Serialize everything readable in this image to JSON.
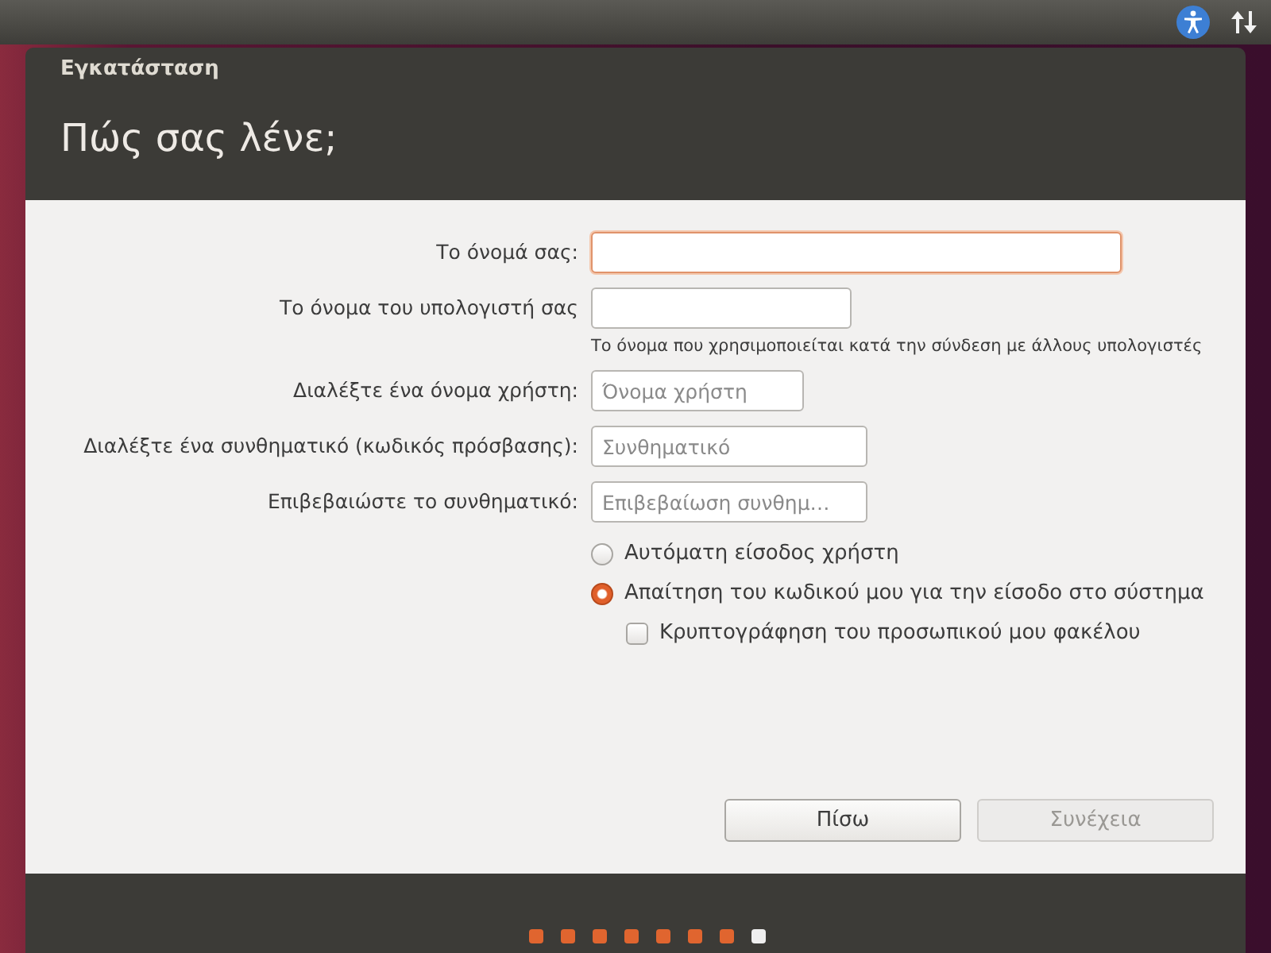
{
  "window": {
    "title": "Εγκατάσταση",
    "heading": "Πώς σας λένε;"
  },
  "fields": [
    {
      "label": "Το όνομά σας:",
      "focused": true
    },
    {
      "label": "Το όνομα του υπολογιστή σας",
      "focused": false,
      "hint": "Το όνομα που χρησιμοποιείται κατά την σύνδεση με άλλους υπολογιστές"
    },
    {
      "label": "Διαλέξτε ένα όνομα χρήστη:",
      "focused": false,
      "placeholder": "Όνομα χρήστη"
    },
    {
      "label": "Διαλέξτε ένα συνθηματικό (κωδικός πρόσβασης):",
      "focused": false,
      "placeholder": "Συνθηματικό"
    },
    {
      "label": "Επιβεβαιώστε το συνθηματικό:",
      "focused": false,
      "placeholder": "Επιβεβαίωση συνθημ…"
    }
  ],
  "login_options": [
    {
      "label": "Αυτόματη είσοδος χρήστη",
      "selected": false
    },
    {
      "label": "Απαίτηση του κωδικού μου για την είσοδο στο σύστημα",
      "selected": true
    }
  ],
  "encrypt": {
    "label": "Κρυπτογράφηση του προσωπικού μου φακέλου",
    "checked": false
  },
  "buttons": [
    {
      "label": "Πίσω",
      "disabled": false
    },
    {
      "label": "Συνέχεια",
      "disabled": true
    }
  ],
  "steps": [
    {
      "done": true
    },
    {
      "done": true
    },
    {
      "done": true
    },
    {
      "done": true
    },
    {
      "done": true
    },
    {
      "done": true
    },
    {
      "done": true
    },
    {
      "done": false
    }
  ]
}
